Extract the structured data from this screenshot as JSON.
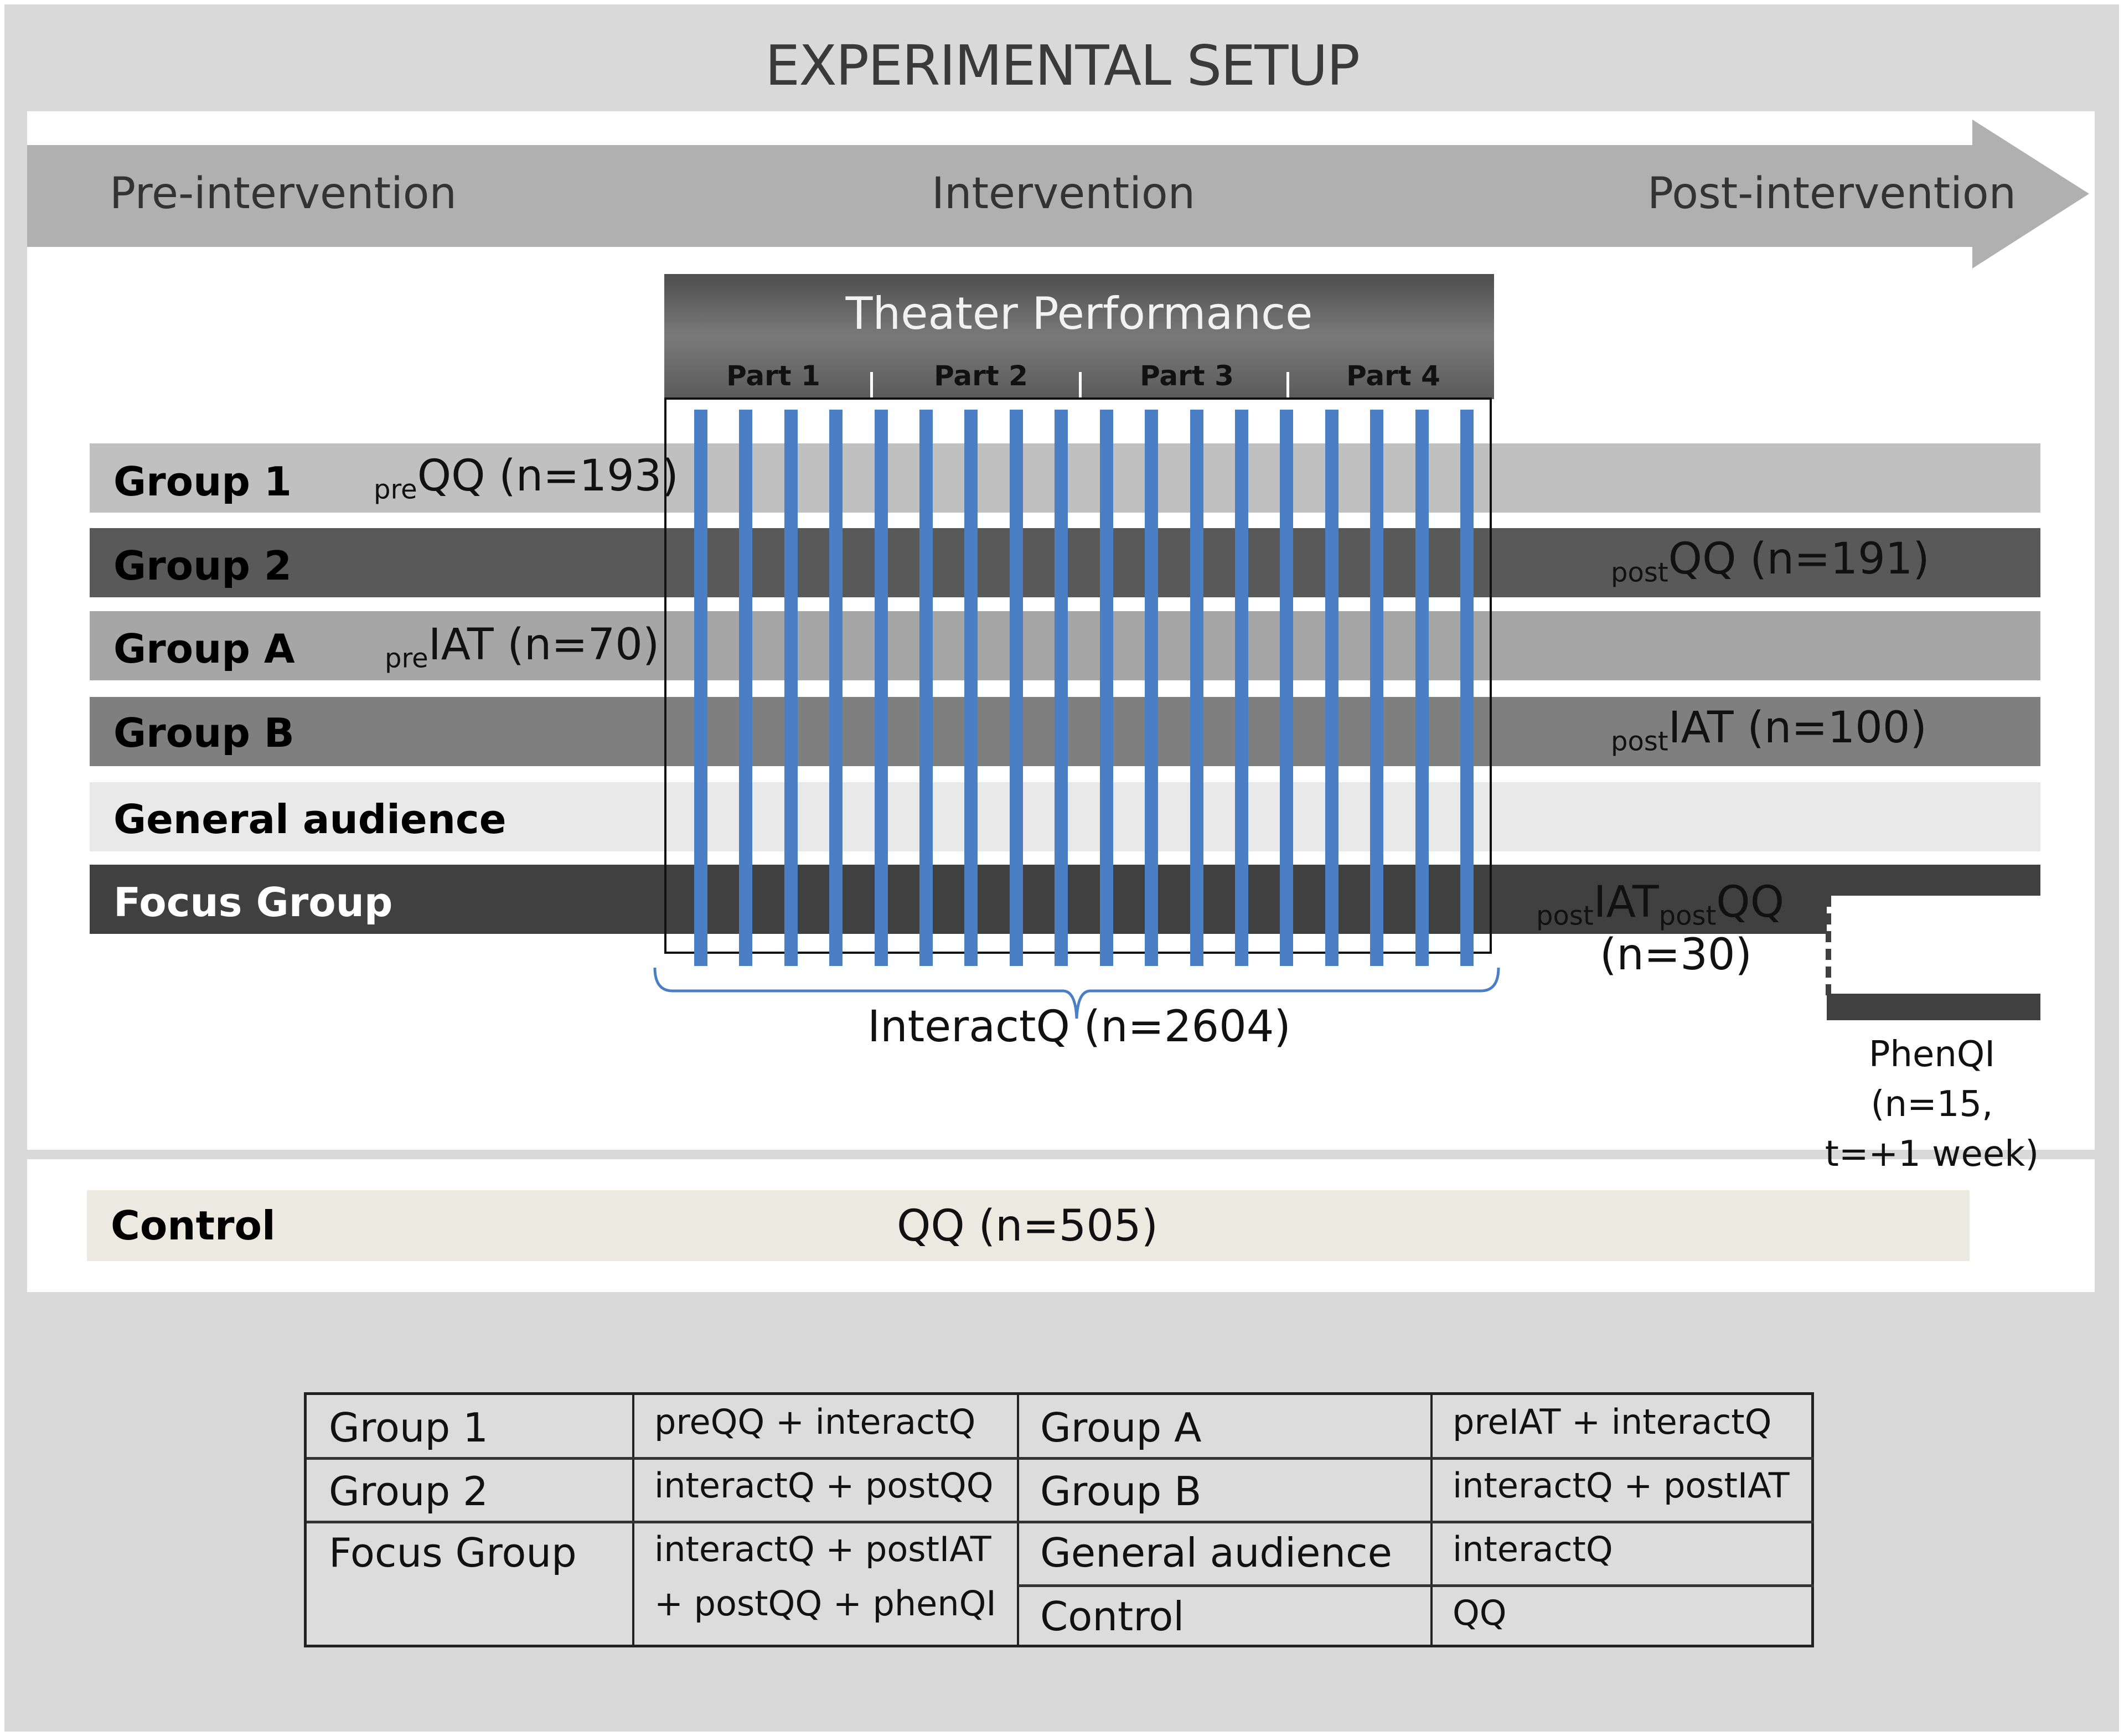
{
  "title": "EXPERIMENTAL SETUP",
  "timeline": {
    "phases": [
      "Pre-intervention",
      "Intervention",
      "Post-intervention"
    ]
  },
  "theater": {
    "title": "Theater Performance",
    "parts": [
      "Part 1",
      "Part 2",
      "Part 3",
      "Part 4"
    ],
    "interaction_points": 18,
    "interact_label": "InteractQ (n=2604)"
  },
  "groups": [
    {
      "label": "Group 1",
      "pre": {
        "sub": "pre",
        "text": "QQ (n=193)"
      },
      "post": null,
      "shade": "#c0c0c0",
      "text_color": "#111111"
    },
    {
      "label": "Group 2",
      "pre": null,
      "post": {
        "sub": "post",
        "text": "QQ (n=191)"
      },
      "shade": "#595959",
      "text_color": "#111111"
    },
    {
      "label": "Group A",
      "pre": {
        "sub": "pre",
        "text": "IAT (n=70)"
      },
      "post": null,
      "shade": "#a6a6a6",
      "text_color": "#111111"
    },
    {
      "label": "Group B",
      "pre": null,
      "post": {
        "sub": "post",
        "text": "IAT (n=100)"
      },
      "shade": "#7f7f7f",
      "text_color": "#111111"
    },
    {
      "label": "General audience",
      "pre": null,
      "post": null,
      "shade": "#e9e9e9",
      "text_color": "#111111"
    },
    {
      "label": "Focus Group",
      "pre": null,
      "post": null,
      "shade": "#404040",
      "text_color": "#ffffff"
    }
  ],
  "focus_group": {
    "post_sub1": "post",
    "post_text1": "IAT",
    "post_sub2": "post",
    "post_text2": "QQ",
    "n_label": "(n=30)",
    "phenqi_line1": "PhenQI (n=15,",
    "phenqi_line2": "t=+1 week)"
  },
  "control": {
    "label": "Control",
    "note": "QQ (n=505)",
    "shade": "#eceae0"
  },
  "legend_table": {
    "left": [
      {
        "group": "Group 1",
        "measures": "preQQ + interactQ"
      },
      {
        "group": "Group 2",
        "measures": "interactQ + postQQ"
      },
      {
        "group": "Focus Group",
        "measures_line1": "interactQ + postIAT",
        "measures_line2": "+ postQQ + phenQI"
      }
    ],
    "right": [
      {
        "group": "Group A",
        "measures": "preIAT + interactQ"
      },
      {
        "group": "Group B",
        "measures": "interactQ + postIAT"
      },
      {
        "group": "General audience",
        "measures": "interactQ"
      },
      {
        "group": "Control",
        "measures": "QQ"
      }
    ]
  },
  "colors": {
    "frame": "#d9d9d9",
    "arrow": "#b0b0b0",
    "interaction_line": "#4a7fc5",
    "bracket": "#4a7fc5"
  }
}
